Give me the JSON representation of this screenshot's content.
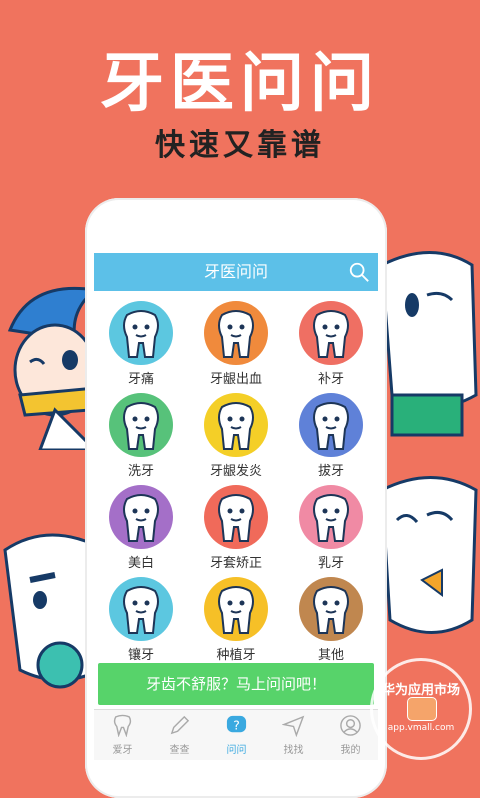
{
  "hero": {
    "title": "牙医问问",
    "subtitle": "快速又靠谱"
  },
  "app": {
    "title": "牙医问问",
    "categories": [
      {
        "label": "牙痛",
        "color": "#5cc7e0"
      },
      {
        "label": "牙龈出血",
        "color": "#f08a3c"
      },
      {
        "label": "补牙",
        "color": "#ef6f63"
      },
      {
        "label": "洗牙",
        "color": "#57c27a"
      },
      {
        "label": "牙龈发炎",
        "color": "#f4cf27"
      },
      {
        "label": "拔牙",
        "color": "#5f81d8"
      },
      {
        "label": "美白",
        "color": "#a46fc8"
      },
      {
        "label": "牙套矫正",
        "color": "#f06a5a"
      },
      {
        "label": "乳牙",
        "color": "#f08aa4"
      },
      {
        "label": "镶牙",
        "color": "#5cc7e0"
      },
      {
        "label": "种植牙",
        "color": "#f6c027"
      },
      {
        "label": "其他",
        "color": "#c0874f"
      }
    ],
    "ask_button": "牙齿不舒服？马上问问吧！",
    "tabs": [
      {
        "label": "爱牙",
        "icon": "tooth-icon"
      },
      {
        "label": "查查",
        "icon": "pencil-icon"
      },
      {
        "label": "问问",
        "icon": "question-icon"
      },
      {
        "label": "找找",
        "icon": "navigate-icon"
      },
      {
        "label": "我的",
        "icon": "user-icon"
      }
    ],
    "active_tab": "问问"
  },
  "watermark": {
    "top": "华为应用市场",
    "bottom": "app.vmall.com"
  },
  "colors": {
    "background": "#f0735e",
    "header": "#5cc0e8",
    "ask_button": "#57d36a",
    "active_tab": "#3aa9e0"
  }
}
